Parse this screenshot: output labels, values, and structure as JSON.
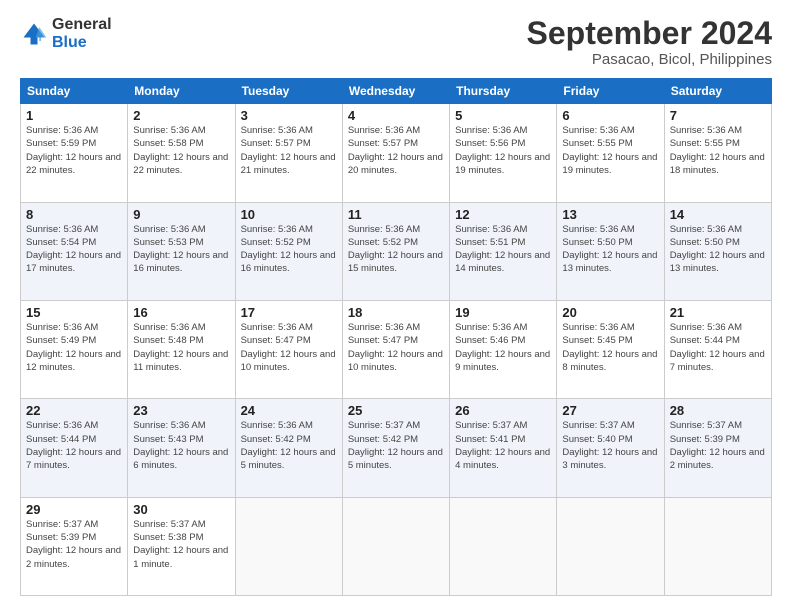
{
  "app": {
    "logo_line1": "General",
    "logo_line2": "Blue"
  },
  "header": {
    "title": "September 2024",
    "subtitle": "Pasacao, Bicol, Philippines"
  },
  "calendar": {
    "columns": [
      "Sunday",
      "Monday",
      "Tuesday",
      "Wednesday",
      "Thursday",
      "Friday",
      "Saturday"
    ],
    "weeks": [
      [
        null,
        {
          "day": 2,
          "sunrise": "5:36 AM",
          "sunset": "5:58 PM",
          "daylight": "12 hours and 22 minutes."
        },
        {
          "day": 3,
          "sunrise": "5:36 AM",
          "sunset": "5:57 PM",
          "daylight": "12 hours and 21 minutes."
        },
        {
          "day": 4,
          "sunrise": "5:36 AM",
          "sunset": "5:57 PM",
          "daylight": "12 hours and 20 minutes."
        },
        {
          "day": 5,
          "sunrise": "5:36 AM",
          "sunset": "5:56 PM",
          "daylight": "12 hours and 19 minutes."
        },
        {
          "day": 6,
          "sunrise": "5:36 AM",
          "sunset": "5:55 PM",
          "daylight": "12 hours and 19 minutes."
        },
        {
          "day": 7,
          "sunrise": "5:36 AM",
          "sunset": "5:55 PM",
          "daylight": "12 hours and 18 minutes."
        }
      ],
      [
        {
          "day": 8,
          "sunrise": "5:36 AM",
          "sunset": "5:54 PM",
          "daylight": "12 hours and 17 minutes."
        },
        {
          "day": 9,
          "sunrise": "5:36 AM",
          "sunset": "5:53 PM",
          "daylight": "12 hours and 16 minutes."
        },
        {
          "day": 10,
          "sunrise": "5:36 AM",
          "sunset": "5:52 PM",
          "daylight": "12 hours and 16 minutes."
        },
        {
          "day": 11,
          "sunrise": "5:36 AM",
          "sunset": "5:52 PM",
          "daylight": "12 hours and 15 minutes."
        },
        {
          "day": 12,
          "sunrise": "5:36 AM",
          "sunset": "5:51 PM",
          "daylight": "12 hours and 14 minutes."
        },
        {
          "day": 13,
          "sunrise": "5:36 AM",
          "sunset": "5:50 PM",
          "daylight": "12 hours and 13 minutes."
        },
        {
          "day": 14,
          "sunrise": "5:36 AM",
          "sunset": "5:50 PM",
          "daylight": "12 hours and 13 minutes."
        }
      ],
      [
        {
          "day": 15,
          "sunrise": "5:36 AM",
          "sunset": "5:49 PM",
          "daylight": "12 hours and 12 minutes."
        },
        {
          "day": 16,
          "sunrise": "5:36 AM",
          "sunset": "5:48 PM",
          "daylight": "12 hours and 11 minutes."
        },
        {
          "day": 17,
          "sunrise": "5:36 AM",
          "sunset": "5:47 PM",
          "daylight": "12 hours and 10 minutes."
        },
        {
          "day": 18,
          "sunrise": "5:36 AM",
          "sunset": "5:47 PM",
          "daylight": "12 hours and 10 minutes."
        },
        {
          "day": 19,
          "sunrise": "5:36 AM",
          "sunset": "5:46 PM",
          "daylight": "12 hours and 9 minutes."
        },
        {
          "day": 20,
          "sunrise": "5:36 AM",
          "sunset": "5:45 PM",
          "daylight": "12 hours and 8 minutes."
        },
        {
          "day": 21,
          "sunrise": "5:36 AM",
          "sunset": "5:44 PM",
          "daylight": "12 hours and 7 minutes."
        }
      ],
      [
        {
          "day": 22,
          "sunrise": "5:36 AM",
          "sunset": "5:44 PM",
          "daylight": "12 hours and 7 minutes."
        },
        {
          "day": 23,
          "sunrise": "5:36 AM",
          "sunset": "5:43 PM",
          "daylight": "12 hours and 6 minutes."
        },
        {
          "day": 24,
          "sunrise": "5:36 AM",
          "sunset": "5:42 PM",
          "daylight": "12 hours and 5 minutes."
        },
        {
          "day": 25,
          "sunrise": "5:37 AM",
          "sunset": "5:42 PM",
          "daylight": "12 hours and 5 minutes."
        },
        {
          "day": 26,
          "sunrise": "5:37 AM",
          "sunset": "5:41 PM",
          "daylight": "12 hours and 4 minutes."
        },
        {
          "day": 27,
          "sunrise": "5:37 AM",
          "sunset": "5:40 PM",
          "daylight": "12 hours and 3 minutes."
        },
        {
          "day": 28,
          "sunrise": "5:37 AM",
          "sunset": "5:39 PM",
          "daylight": "12 hours and 2 minutes."
        }
      ],
      [
        {
          "day": 29,
          "sunrise": "5:37 AM",
          "sunset": "5:39 PM",
          "daylight": "12 hours and 2 minutes."
        },
        {
          "day": 30,
          "sunrise": "5:37 AM",
          "sunset": "5:38 PM",
          "daylight": "12 hours and 1 minute."
        },
        null,
        null,
        null,
        null,
        null
      ]
    ],
    "week1_sun": {
      "day": 1,
      "sunrise": "5:36 AM",
      "sunset": "5:59 PM",
      "daylight": "12 hours and 22 minutes."
    }
  }
}
